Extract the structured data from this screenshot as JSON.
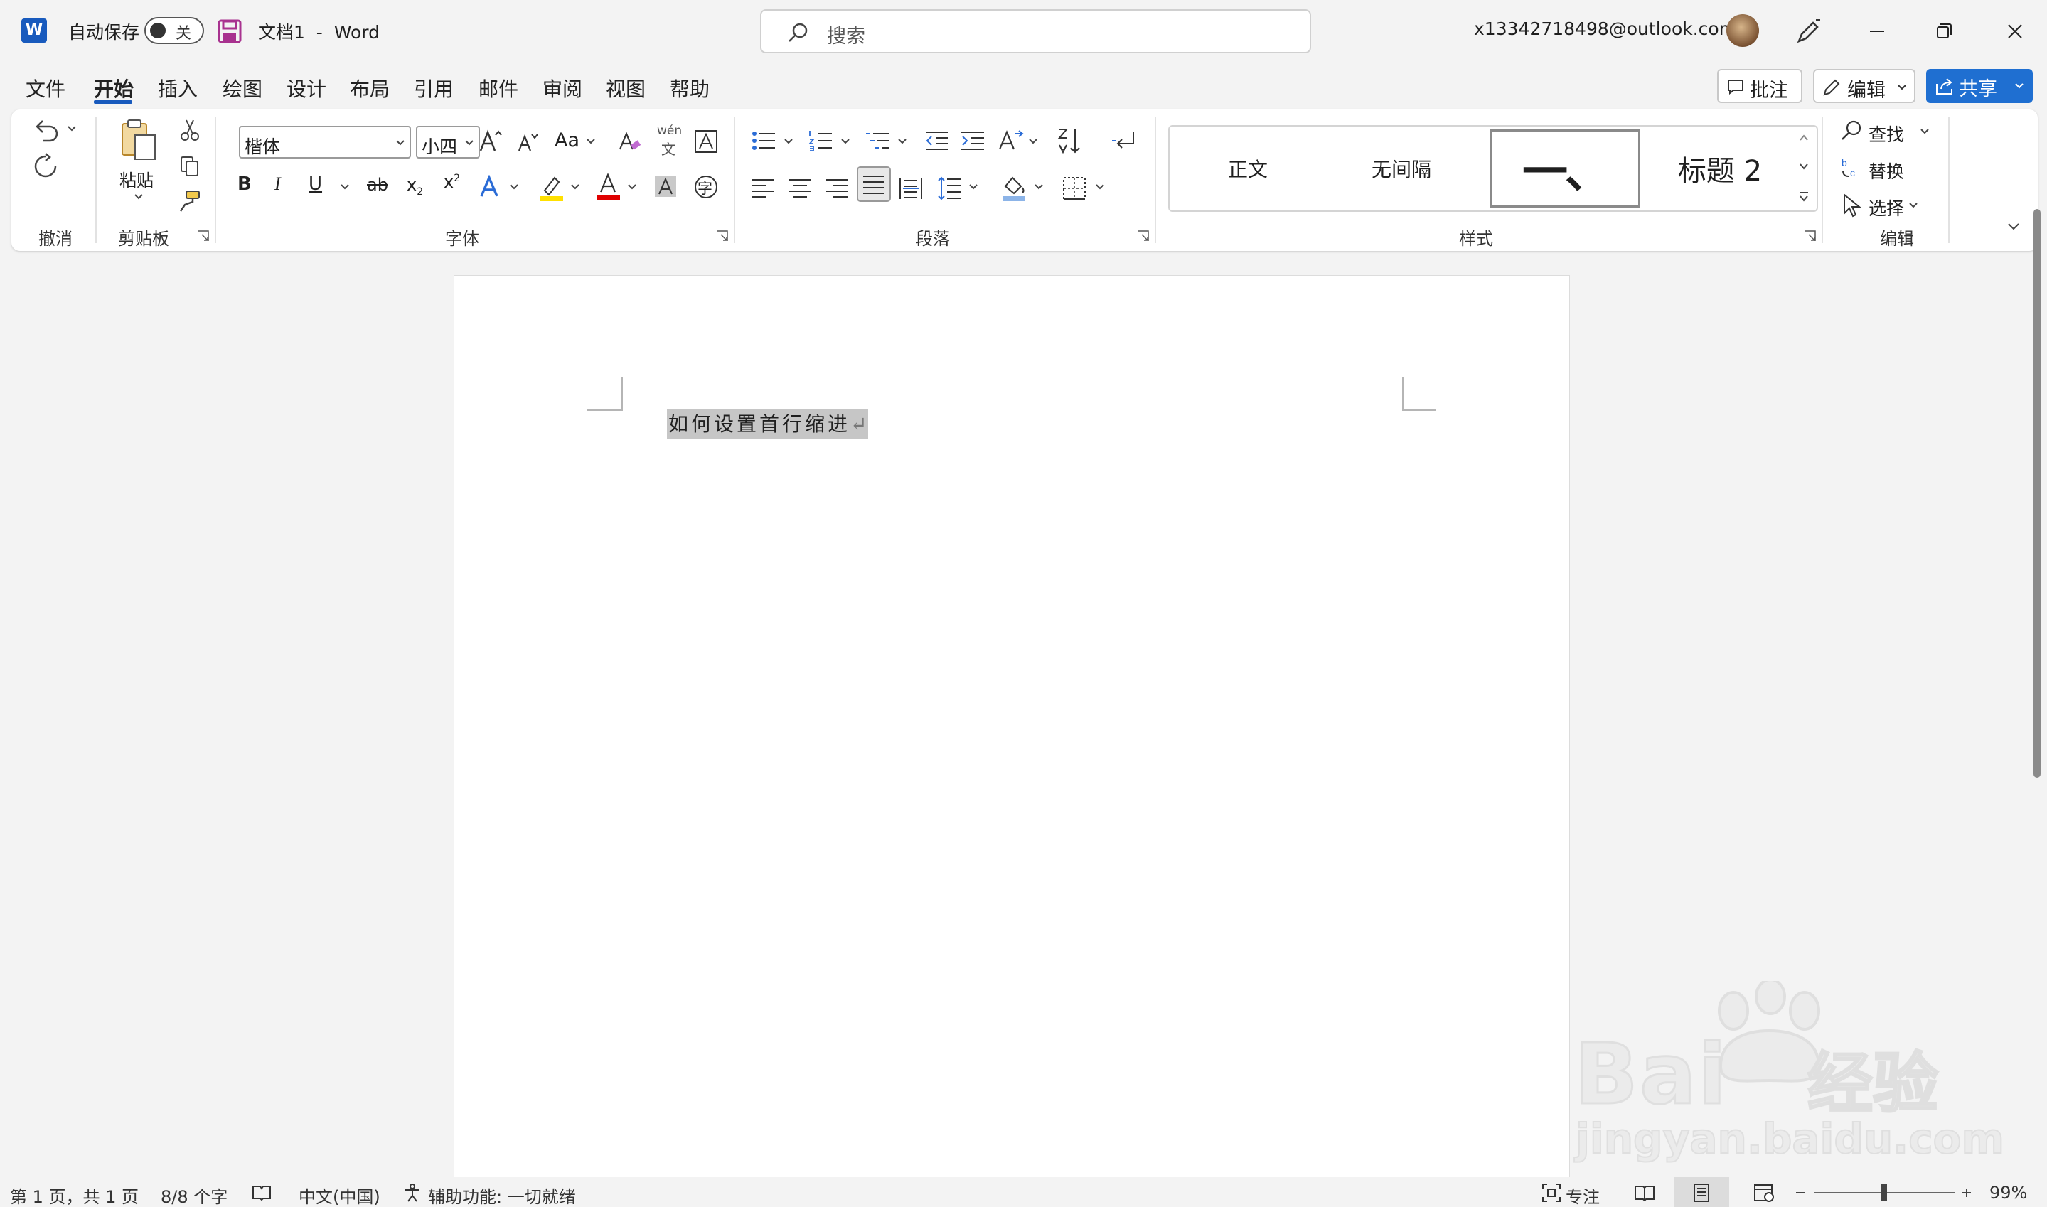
{
  "titlebar": {
    "app_letter": "W",
    "autosave_label": "自动保存",
    "autosave_state": "关",
    "document_title": "文档1  -  Word",
    "search_placeholder": "搜索",
    "account_email": "x13342718498@outlook.com"
  },
  "tabs": [
    {
      "label": "文件",
      "active": false
    },
    {
      "label": "开始",
      "active": true
    },
    {
      "label": "插入",
      "active": false
    },
    {
      "label": "绘图",
      "active": false
    },
    {
      "label": "设计",
      "active": false
    },
    {
      "label": "布局",
      "active": false
    },
    {
      "label": "引用",
      "active": false
    },
    {
      "label": "邮件",
      "active": false
    },
    {
      "label": "审阅",
      "active": false
    },
    {
      "label": "视图",
      "active": false
    },
    {
      "label": "帮助",
      "active": false
    }
  ],
  "actions": {
    "comments": "批注",
    "editing": "编辑",
    "share": "共享"
  },
  "ribbon": {
    "groups": {
      "undo": "撤消",
      "clipboard": "剪贴板",
      "font": "字体",
      "paragraph": "段落",
      "styles": "样式",
      "editing": "编辑"
    },
    "paste_label": "粘贴",
    "font_name": "楷体",
    "font_size": "小四",
    "case_label": "Aa",
    "phonetic_top": "wén",
    "phonetic_bottom": "文",
    "enclose_char": "字",
    "styles": {
      "normal": "正文",
      "no_spacing": "无间隔",
      "heading1": "一、",
      "heading2": "标题 2"
    },
    "find": "查找",
    "replace": "替换",
    "select": "选择"
  },
  "document": {
    "text": "如何设置首行缩进",
    "paragraph_mark": "↵"
  },
  "statusbar": {
    "page": "第 1 页，共 1 页",
    "words": "8/8 个字",
    "language": "中文(中国)",
    "accessibility": "辅助功能: 一切就绪",
    "focus": "专注",
    "zoom": "99%",
    "zoom_level": 0.99
  },
  "watermark": {
    "brand": "Bai",
    "brand_cn": "经验",
    "url": "jingyan.baidu.com"
  },
  "colors": {
    "accent": "#185abd",
    "share": "#1f6fd1",
    "highlight": "#ffe000",
    "font_color": "#e00000",
    "text_selection": "#c6c6c6"
  }
}
